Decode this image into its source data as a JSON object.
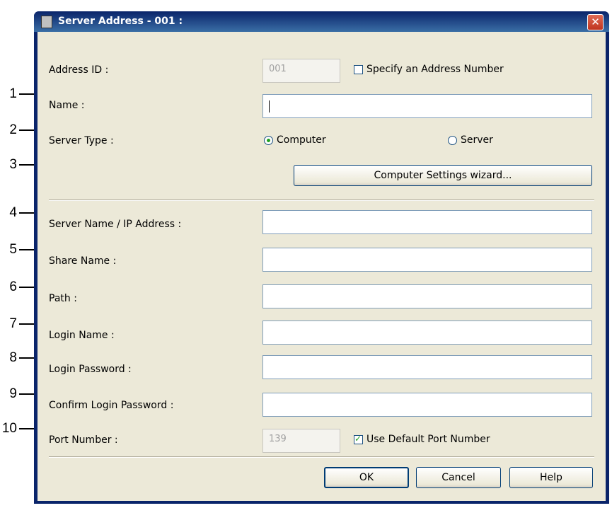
{
  "window": {
    "title": "Server Address - 001 :",
    "close_glyph": "✕"
  },
  "callouts": [
    "1",
    "2",
    "3",
    "4",
    "5",
    "6",
    "7",
    "8",
    "9",
    "10"
  ],
  "address_id": {
    "label": "Address ID :",
    "value": "001",
    "checkbox_label": "Specify an Address Number",
    "checked": false
  },
  "name": {
    "label": "Name :",
    "value": ""
  },
  "server_type": {
    "label": "Server Type :",
    "options": [
      "Computer",
      "Server"
    ],
    "selected": "Computer"
  },
  "wizard_button": "Computer Settings wizard...",
  "server_name": {
    "label": "Server Name / IP Address :",
    "value": ""
  },
  "share_name": {
    "label": "Share Name :",
    "value": ""
  },
  "path": {
    "label": "Path :",
    "value": ""
  },
  "login_name": {
    "label": "Login Name :",
    "value": ""
  },
  "login_password": {
    "label": "Login Password :",
    "value": ""
  },
  "confirm_password": {
    "label": "Confirm Login Password :",
    "value": ""
  },
  "port": {
    "label": "Port Number :",
    "value": "139",
    "checkbox_label": "Use Default Port Number",
    "checked": true
  },
  "buttons": {
    "ok": "OK",
    "cancel": "Cancel",
    "help": "Help"
  },
  "colors": {
    "titlebar": "#0a246a",
    "dialog_bg": "#ece9d8",
    "accent_check": "#21a121"
  }
}
